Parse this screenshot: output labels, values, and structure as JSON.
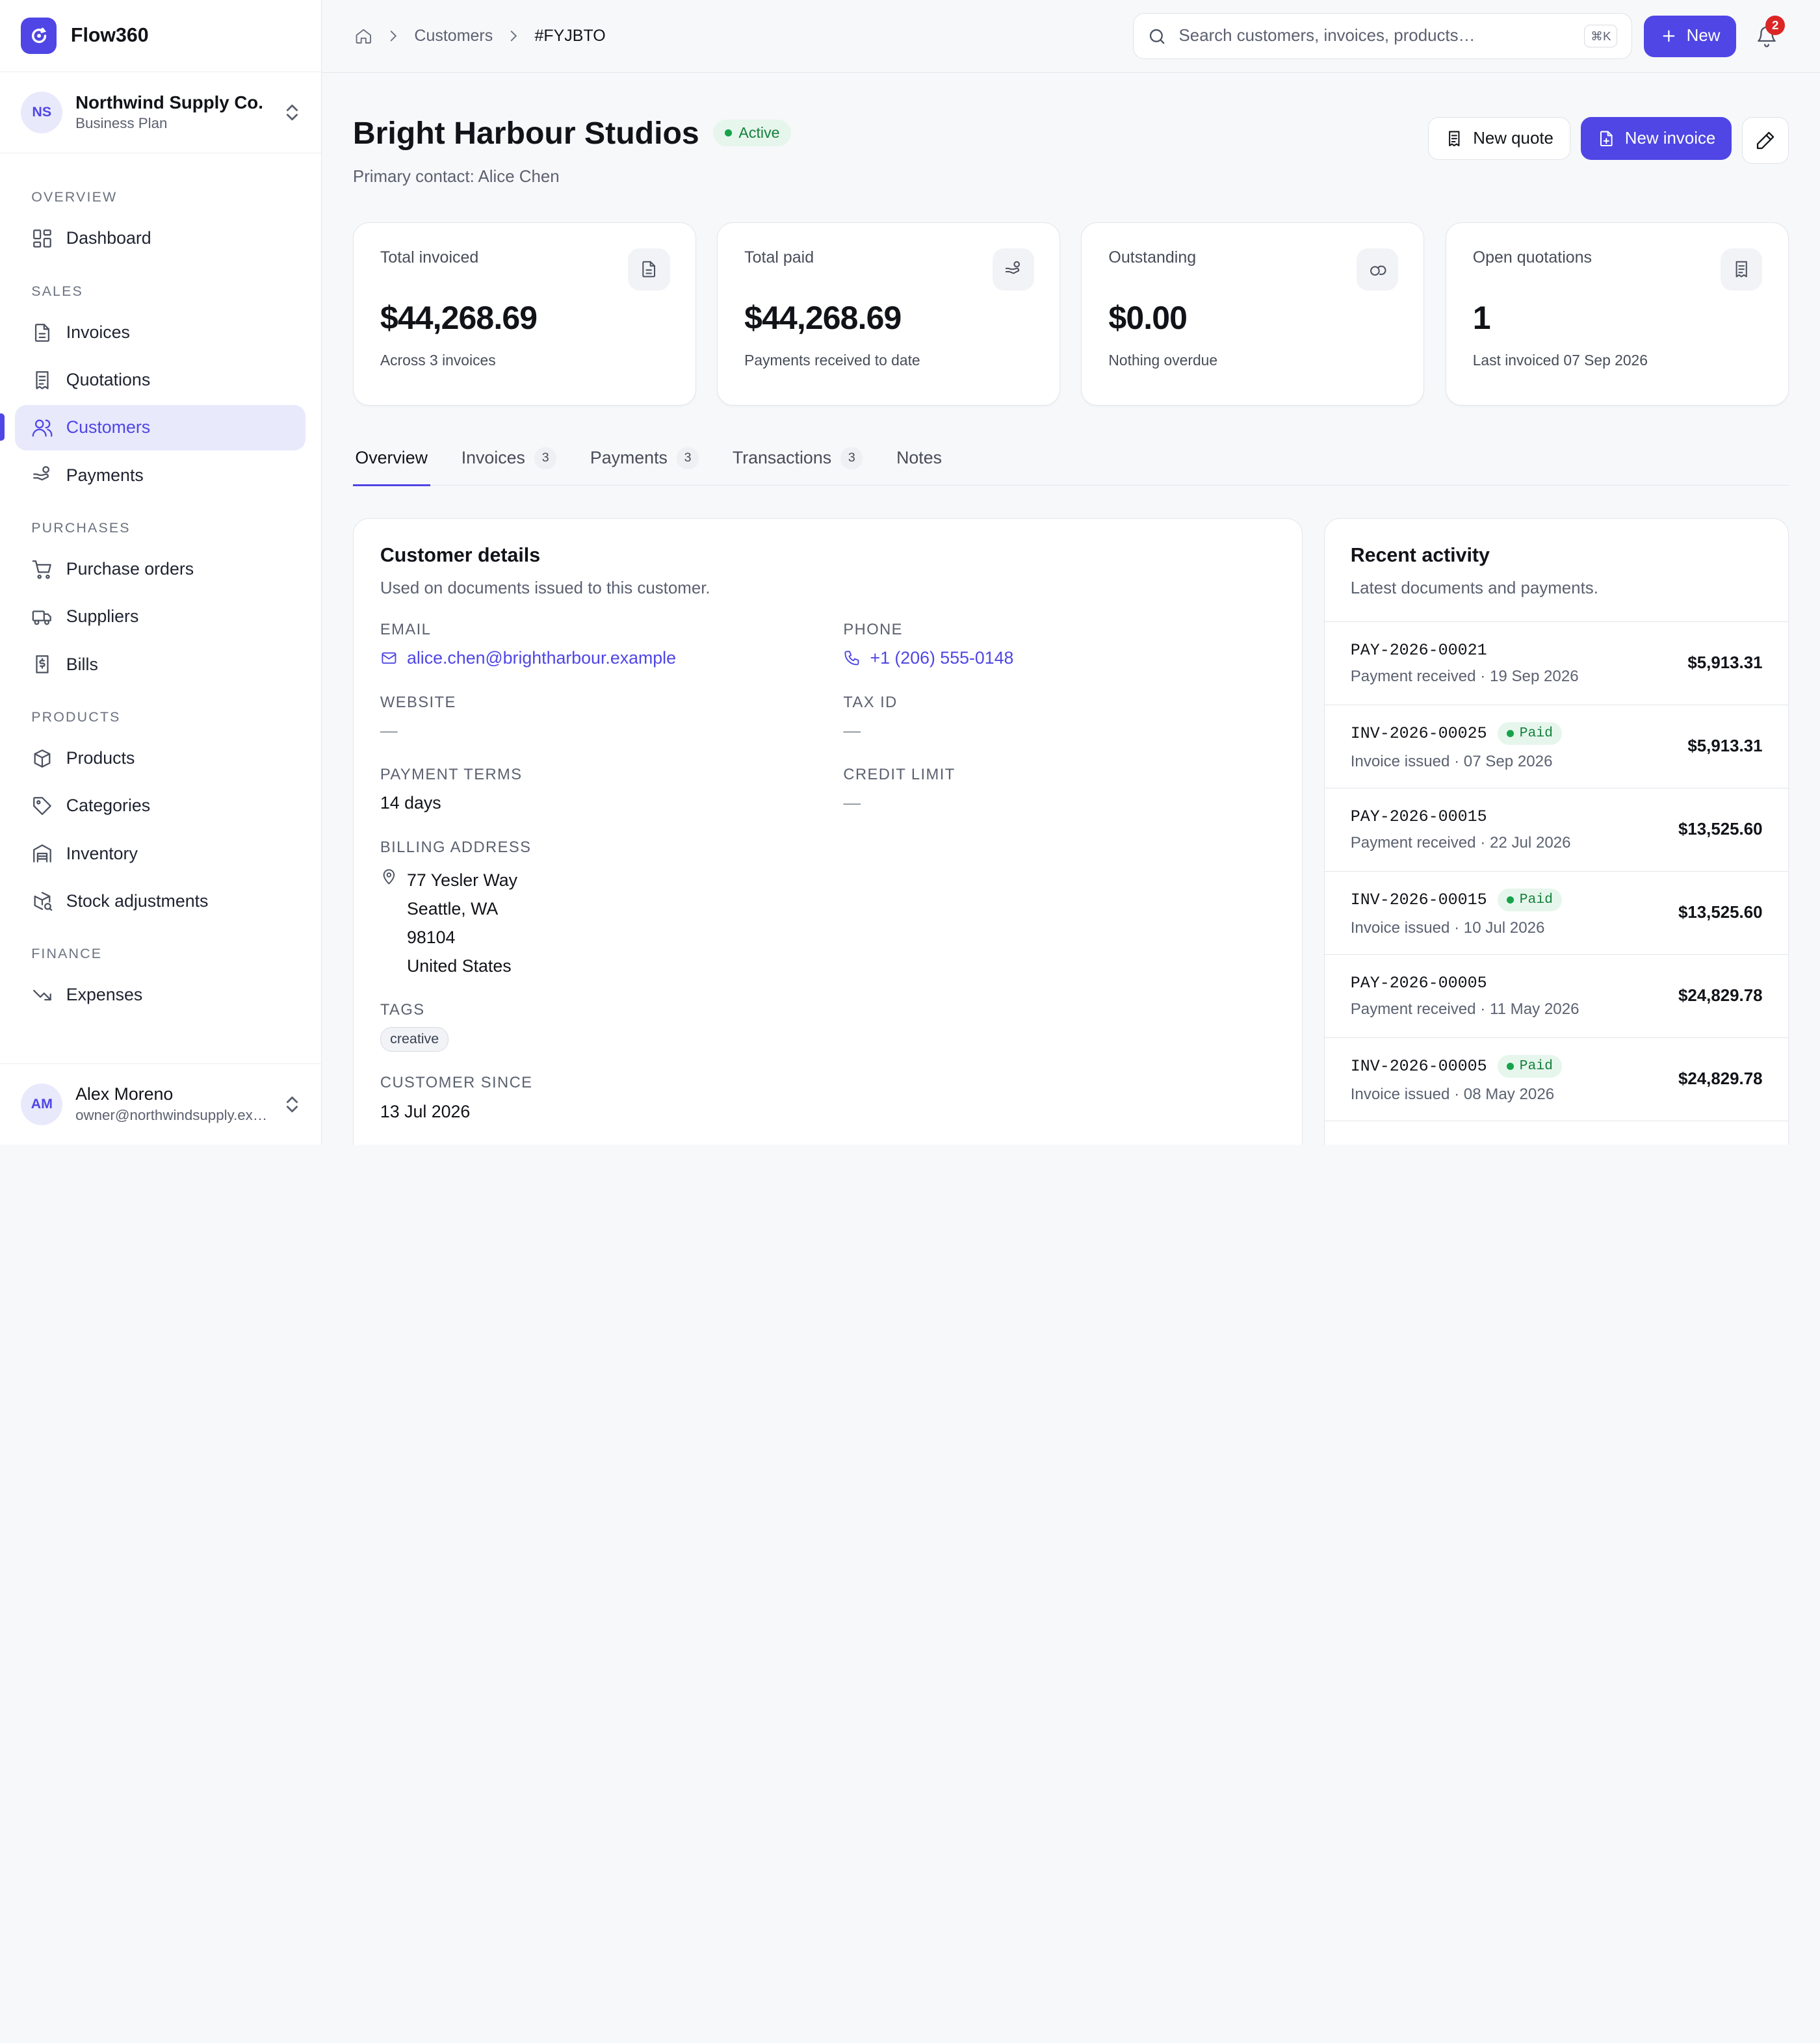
{
  "app": {
    "name": "Flow360"
  },
  "org": {
    "initials": "NS",
    "name": "Northwind Supply Co.",
    "plan": "Business Plan"
  },
  "nav": {
    "sections": [
      {
        "title": "OVERVIEW",
        "items": [
          {
            "label": "Dashboard",
            "icon": "dashboard-icon"
          }
        ]
      },
      {
        "title": "SALES",
        "items": [
          {
            "label": "Invoices",
            "icon": "invoice-icon"
          },
          {
            "label": "Quotations",
            "icon": "quotation-icon"
          },
          {
            "label": "Customers",
            "icon": "users-icon",
            "active": true
          },
          {
            "label": "Payments",
            "icon": "payments-icon"
          }
        ]
      },
      {
        "title": "PURCHASES",
        "items": [
          {
            "label": "Purchase orders",
            "icon": "cart-icon"
          },
          {
            "label": "Suppliers",
            "icon": "truck-icon"
          },
          {
            "label": "Bills",
            "icon": "bill-icon"
          }
        ]
      },
      {
        "title": "PRODUCTS",
        "items": [
          {
            "label": "Products",
            "icon": "box-icon"
          },
          {
            "label": "Categories",
            "icon": "tag-icon"
          },
          {
            "label": "Inventory",
            "icon": "warehouse-icon"
          },
          {
            "label": "Stock adjustments",
            "icon": "stock-adjust-icon"
          }
        ]
      },
      {
        "title": "FINANCE",
        "items": [
          {
            "label": "Expenses",
            "icon": "trending-down-icon"
          }
        ]
      }
    ]
  },
  "user": {
    "initials": "AM",
    "name": "Alex Moreno",
    "email": "owner@northwindsupply.example"
  },
  "topbar": {
    "breadcrumb": [
      "Customers",
      "#FYJBTO"
    ],
    "search_placeholder": "Search customers, invoices, products…",
    "shortcut": "⌘K",
    "new_label": "New",
    "notifications": "2"
  },
  "customer": {
    "name": "Bright Harbour Studios",
    "status": "Active",
    "primary_contact": "Primary contact: Alice Chen",
    "actions": {
      "quote": "New quote",
      "invoice": "New invoice"
    }
  },
  "stats": [
    {
      "label": "Total invoiced",
      "value": "$44,268.69",
      "sub": "Across 3 invoices",
      "icon": "document-icon"
    },
    {
      "label": "Total paid",
      "value": "$44,268.69",
      "sub": "Payments received to date",
      "icon": "hand-coins-icon"
    },
    {
      "label": "Outstanding",
      "value": "$0.00",
      "sub": "Nothing overdue",
      "icon": "coins-icon"
    },
    {
      "label": "Open quotations",
      "value": "1",
      "sub": "Last invoiced 07 Sep 2026",
      "icon": "receipt-icon"
    }
  ],
  "tabs": [
    {
      "label": "Overview",
      "active": true
    },
    {
      "label": "Invoices",
      "count": "3"
    },
    {
      "label": "Payments",
      "count": "3"
    },
    {
      "label": "Transactions",
      "count": "3"
    },
    {
      "label": "Notes"
    }
  ],
  "details": {
    "title": "Customer details",
    "subtitle": "Used on documents issued to this customer.",
    "email_label": "EMAIL",
    "email": "alice.chen@brightharbour.example",
    "phone_label": "PHONE",
    "phone": "+1 (206) 555-0148",
    "website_label": "WEBSITE",
    "website": "—",
    "tax_label": "TAX ID",
    "tax": "—",
    "terms_label": "PAYMENT TERMS",
    "terms": "14 days",
    "credit_label": "CREDIT LIMIT",
    "credit": "—",
    "address_label": "BILLING ADDRESS",
    "address": [
      "77 Yesler Way",
      "Seattle, WA",
      "98104",
      "United States"
    ],
    "tags_label": "TAGS",
    "tags": [
      "creative"
    ],
    "since_label": "CUSTOMER SINCE",
    "since": "13 Jul 2026"
  },
  "activity": {
    "title": "Recent activity",
    "subtitle": "Latest documents and payments.",
    "items": [
      {
        "code": "PAY-2026-00021",
        "sub": "Payment received · 19 Sep 2026",
        "amount": "$5,913.31"
      },
      {
        "code": "INV-2026-00025",
        "badge": "Paid",
        "sub": "Invoice issued · 07 Sep 2026",
        "amount": "$5,913.31"
      },
      {
        "code": "PAY-2026-00015",
        "sub": "Payment received · 22 Jul 2026",
        "amount": "$13,525.60"
      },
      {
        "code": "INV-2026-00015",
        "badge": "Paid",
        "sub": "Invoice issued · 10 Jul 2026",
        "amount": "$13,525.60"
      },
      {
        "code": "PAY-2026-00005",
        "sub": "Payment received · 11 May 2026",
        "amount": "$24,829.78"
      },
      {
        "code": "INV-2026-00005",
        "badge": "Paid",
        "sub": "Invoice issued · 08 May 2026",
        "amount": "$24,829.78"
      }
    ]
  },
  "colors": {
    "accent": "#4f46e5",
    "success": "#15803d",
    "danger": "#dc2626"
  }
}
